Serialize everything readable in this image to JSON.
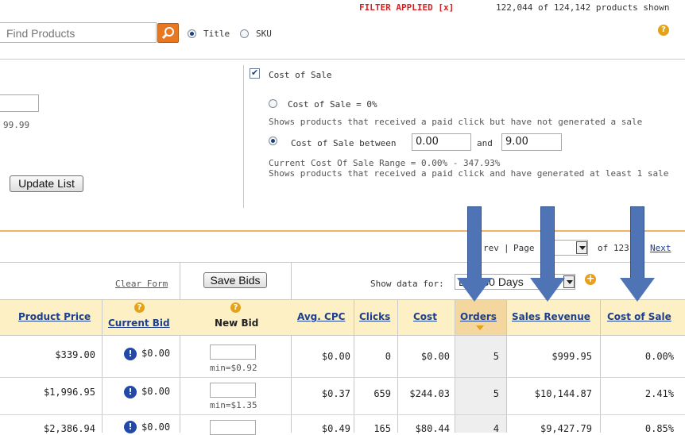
{
  "status": {
    "filter_label": "FILTER APPLIED [x]",
    "count_text": "122,044 of 124,142 products shown"
  },
  "search": {
    "placeholder": "Find Products",
    "option_title": "Title",
    "option_sku": "SKU",
    "selected": "Title"
  },
  "left_filter": {
    "price_value_partial": "99.99",
    "update_button": "Update List"
  },
  "cost_of_sale_filter": {
    "checkbox_label": "Cost of Sale",
    "option_zero_label": "Cost of Sale = 0%",
    "option_zero_desc": "Shows products that received a paid click but have not generated a sale",
    "option_between_label": "Cost of Sale between",
    "between_min": "0.00",
    "and_label": "and",
    "between_max": "9.00",
    "range_text": "Current Cost Of Sale Range =  0.00% - 347.93%",
    "between_desc": "Shows products that received a paid click and have generated at least 1 sale"
  },
  "pagination": {
    "prev_partial": "rev",
    "separator": "|",
    "page_label": "Page",
    "of_text": "of 123",
    "next_label": "Next"
  },
  "toolbar": {
    "clear_form": "Clear Form",
    "save_bids": "Save Bids",
    "show_data_label": "Show data for:",
    "period_value": "Last 30 Days"
  },
  "table": {
    "headers": {
      "product_price": "Product Price",
      "current_bid": "Current Bid",
      "new_bid": "New Bid",
      "avg_cpc": "Avg. CPC",
      "clicks": "Clicks",
      "cost": "Cost",
      "orders": "Orders",
      "sales_revenue": "Sales Revenue",
      "cost_of_sale": "Cost of Sale"
    },
    "rows": [
      {
        "price": "$339.00",
        "current_bid": "$0.00",
        "min_bid": "min=$0.92",
        "avg_cpc": "$0.00",
        "clicks": "0",
        "cost": "$0.00",
        "orders": "5",
        "revenue": "$999.95",
        "cos": "0.00%"
      },
      {
        "price": "$1,996.95",
        "current_bid": "$0.00",
        "min_bid": "min=$1.35",
        "avg_cpc": "$0.37",
        "clicks": "659",
        "cost": "$244.03",
        "orders": "5",
        "revenue": "$10,144.87",
        "cos": "2.41%"
      },
      {
        "price": "$2,386.94",
        "current_bid": "$0.00",
        "min_bid": "",
        "avg_cpc": "$0.49",
        "clicks": "165",
        "cost": "$80.44",
        "orders": "4",
        "revenue": "$9,427.79",
        "cos": "0.85%"
      }
    ]
  },
  "colors": {
    "filter_red": "#d42020",
    "link_blue": "#1c3f8f",
    "header_bg": "#fdf0c5",
    "arrow_blue": "#4f74b6",
    "search_orange": "#e87722"
  }
}
